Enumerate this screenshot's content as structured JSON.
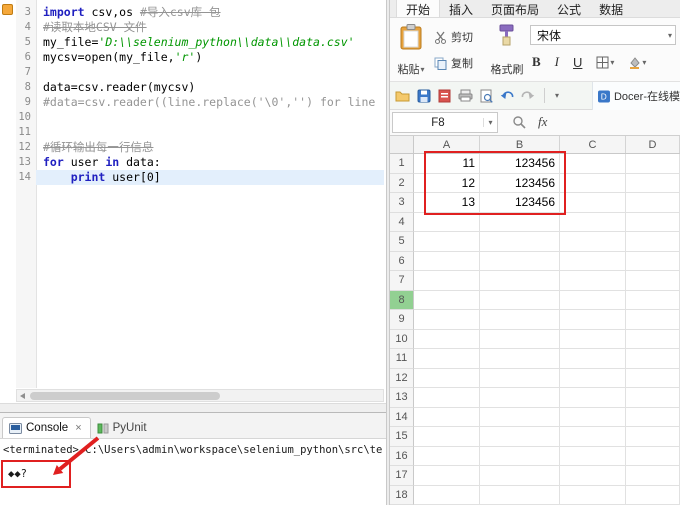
{
  "colors": {
    "annotation_red": "#e02020",
    "keyword": "#2020c0",
    "string": "#009600",
    "comment": "#949494",
    "current_line": "#e3effc",
    "selected_row_header": "#92d092"
  },
  "editor": {
    "lines": [
      {
        "num": "3",
        "segs": [
          {
            "t": "import"
          },
          {
            "t": " csv,os "
          },
          {
            "t": "#导入csv库 包"
          }
        ]
      },
      {
        "num": "4",
        "segs": [
          {
            "t": "#读取本地CSV 文件"
          }
        ]
      },
      {
        "num": "5",
        "segs": [
          {
            "t": "my_file="
          },
          {
            "t": "'D:\\\\selenium_python\\\\data\\\\data.csv'"
          }
        ]
      },
      {
        "num": "6",
        "segs": [
          {
            "t": "mycsv=open(my_file,"
          },
          {
            "t": "'r'"
          },
          {
            "t": ")"
          }
        ]
      },
      {
        "num": "7",
        "segs": []
      },
      {
        "num": "8",
        "segs": [
          {
            "t": "data=csv.reader(mycsv)"
          }
        ]
      },
      {
        "num": "9",
        "segs": [
          {
            "t": "#data=csv.reader((line.replace('\\0','') for line"
          }
        ]
      },
      {
        "num": "10",
        "segs": []
      },
      {
        "num": "11",
        "segs": []
      },
      {
        "num": "12",
        "segs": [
          {
            "t": "#循环输出每一行信息"
          }
        ]
      },
      {
        "num": "13",
        "segs": [
          {
            "t": "for"
          },
          {
            "t": " user "
          },
          {
            "t": "in"
          },
          {
            "t": " data:"
          }
        ]
      },
      {
        "num": "14",
        "segs": [
          {
            "t": "    "
          },
          {
            "t": "print"
          },
          {
            "t": " user[0]"
          }
        ]
      }
    ]
  },
  "console": {
    "tabs": [
      {
        "label": "Console",
        "close": "×"
      },
      {
        "label": "PyUnit"
      }
    ],
    "terminated_line": "<terminated> C:\\Users\\admin\\workspace\\selenium_python\\src\\te",
    "output": "◆◆?"
  },
  "sheet": {
    "ribbon_tabs": [
      "开始",
      "插入",
      "页面布局",
      "公式",
      "数据"
    ],
    "toolbar": {
      "paste": "粘贴",
      "cut": "剪切",
      "copy": "复制",
      "painter": "格式刷",
      "font_name": "宋体",
      "bold": "B",
      "italic": "I",
      "underline": "U"
    },
    "quickbar": {
      "docer": "Docer-在线模"
    },
    "formula_bar": {
      "name_box": "F8",
      "fx": "fx"
    },
    "grid": {
      "cols": [
        "A",
        "B",
        "C",
        "D"
      ],
      "rows": [
        {
          "n": "1",
          "a": "11",
          "b": "123456"
        },
        {
          "n": "2",
          "a": "12",
          "b": "123456"
        },
        {
          "n": "3",
          "a": "13",
          "b": "123456"
        },
        {
          "n": "4"
        },
        {
          "n": "5"
        },
        {
          "n": "6"
        },
        {
          "n": "7"
        },
        {
          "n": "8"
        },
        {
          "n": "9"
        },
        {
          "n": "10"
        },
        {
          "n": "11"
        },
        {
          "n": "12"
        },
        {
          "n": "13"
        },
        {
          "n": "14"
        },
        {
          "n": "15"
        },
        {
          "n": "16"
        },
        {
          "n": "17"
        },
        {
          "n": "18"
        }
      ]
    }
  }
}
